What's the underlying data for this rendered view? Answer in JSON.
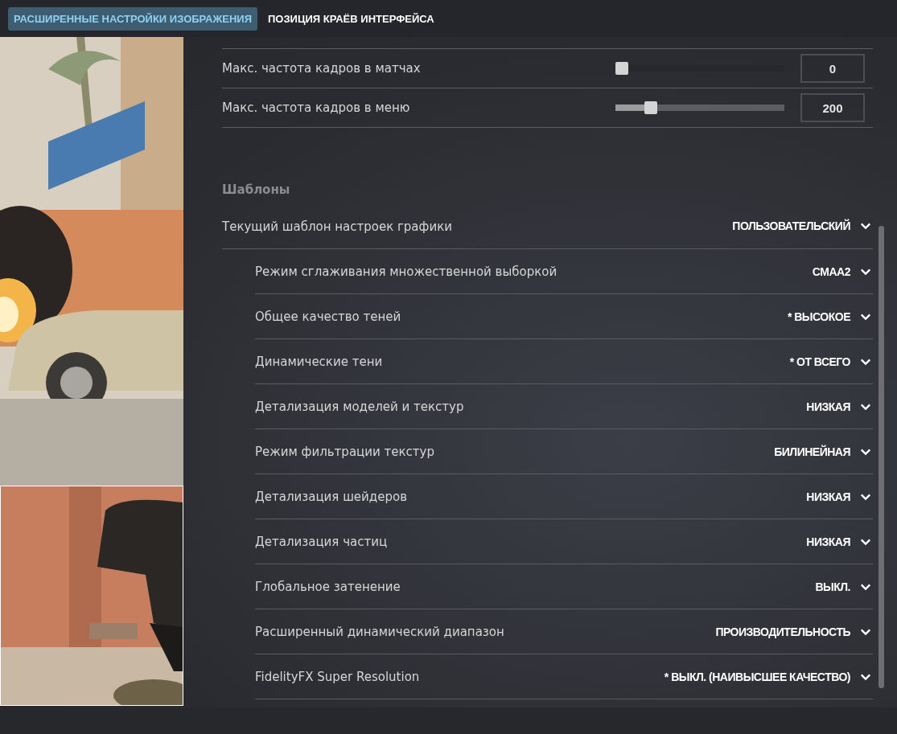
{
  "tabs": [
    {
      "label": "РАСШИРЕННЫЕ НАСТРОЙКИ ИЗОБРАЖЕНИЯ",
      "selected": true
    },
    {
      "label": "ПОЗИЦИЯ КРАЁВ ИНТЕРФЕЙСА",
      "selected": false
    }
  ],
  "sliders": [
    {
      "label": "Макс. частота кадров в матчах",
      "level": 0,
      "value": "0"
    },
    {
      "label": "Макс. частота кадров в меню",
      "level": 0.17,
      "value": "200"
    }
  ],
  "section_title": "Шаблоны",
  "preset": {
    "label": "Текущий шаблон настроек графики",
    "value": "ПОЛЬЗОВАТЕЛЬСКИЙ",
    "children": [
      {
        "label": "Режим сглаживания множественной выборкой",
        "value": "CMAA2"
      },
      {
        "label": "Общее качество теней",
        "value": "* ВЫСОКОЕ"
      },
      {
        "label": "Динамические тени",
        "value": "* ОТ ВСЕГО"
      },
      {
        "label": "Детализация моделей и текстур",
        "value": "НИЗКАЯ"
      },
      {
        "label": "Режим фильтрации текстур",
        "value": "БИЛИНЕЙНАЯ"
      },
      {
        "label": "Детализация шейдеров",
        "value": "НИЗКАЯ"
      },
      {
        "label": "Детализация частиц",
        "value": "НИЗКАЯ"
      },
      {
        "label": "Глобальное затенение",
        "value": "ВЫКЛ."
      },
      {
        "label": "Расширенный динамический диапазон",
        "value": "ПРОИЗВОДИТЕЛЬНОСТЬ"
      },
      {
        "label": "FidelityFX Super Resolution",
        "value": "* ВЫКЛ. (НАИВЫСШЕЕ КАЧЕСТВО)"
      }
    ]
  }
}
